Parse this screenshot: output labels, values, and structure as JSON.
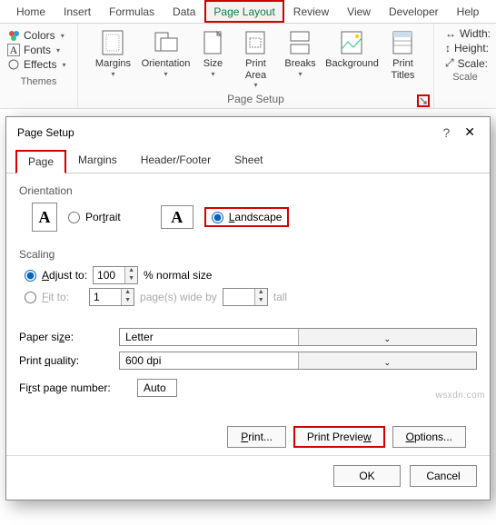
{
  "ribbon": {
    "tabs": [
      "Home",
      "Insert",
      "Formulas",
      "Data",
      "Page Layout",
      "Review",
      "View",
      "Developer",
      "Help"
    ],
    "active_tab": "Page Layout",
    "themes": {
      "colors": "Colors",
      "fonts": "Fonts",
      "effects": "Effects",
      "label": "Themes"
    },
    "page_setup": {
      "margins": "Margins",
      "orientation": "Orientation",
      "size": "Size",
      "print_area": "Print\nArea",
      "breaks": "Breaks",
      "background": "Background",
      "print_titles": "Print\nTitles",
      "label": "Page Setup"
    },
    "scale": {
      "width": "Width:",
      "height": "Height:",
      "scale": "Scale:",
      "label": "Scale"
    }
  },
  "dialog": {
    "title": "Page Setup",
    "tabs": [
      "Page",
      "Margins",
      "Header/Footer",
      "Sheet"
    ],
    "orientation": {
      "label": "Orientation",
      "portrait": "Portrait",
      "landscape": "Landscape",
      "selected": "landscape"
    },
    "scaling": {
      "label": "Scaling",
      "adjust_to": "Adjust to:",
      "adjust_val": "100",
      "adjust_suffix": "% normal size",
      "fit_to": "Fit to:",
      "fit_wide": "1",
      "fit_mid": "page(s) wide by",
      "fit_tall_val": "",
      "fit_tall": "tall"
    },
    "paper_size": {
      "label": "Paper size:",
      "value": "Letter"
    },
    "print_quality": {
      "label": "Print quality:",
      "value": "600 dpi"
    },
    "first_page": {
      "label": "First page number:",
      "value": "Auto"
    },
    "buttons": {
      "print": "Print...",
      "preview": "Print Preview",
      "options": "Options..."
    },
    "footer": {
      "ok": "OK",
      "cancel": "Cancel"
    }
  },
  "watermark": "wsxdn.com"
}
